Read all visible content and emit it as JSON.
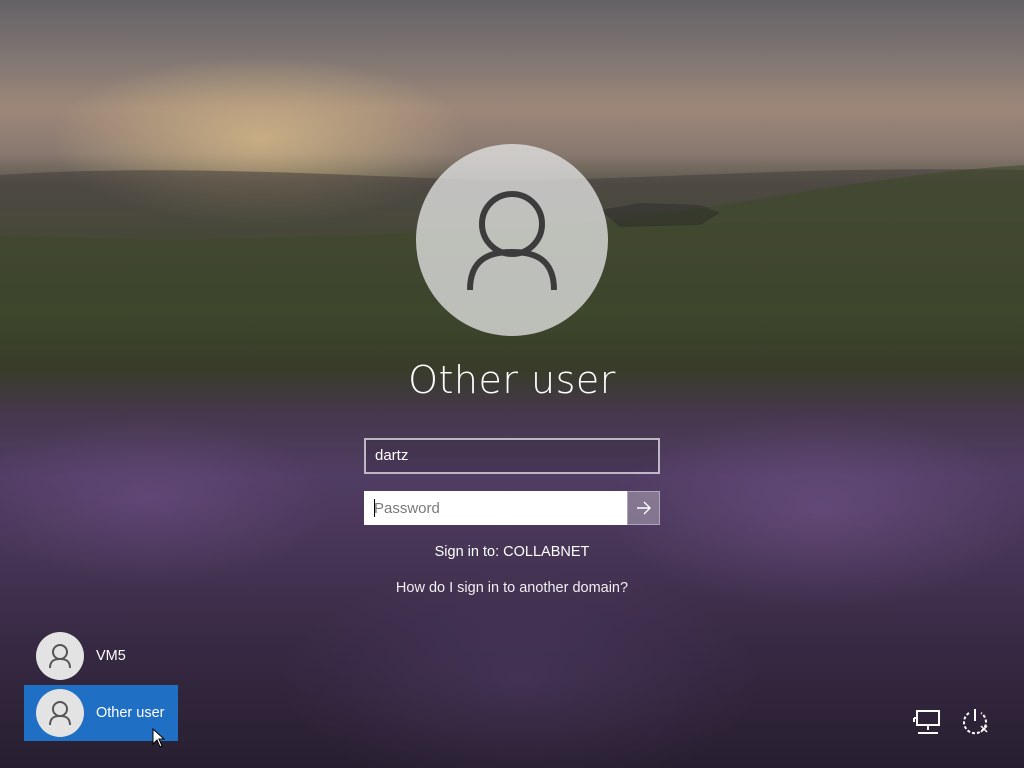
{
  "login": {
    "title": "Other user",
    "username_value": "dartz",
    "password_placeholder": "Password",
    "sign_in_to": "Sign in to: COLLABNET",
    "other_domain_link": "How do I sign in to another domain?"
  },
  "users": [
    {
      "label": "VM5",
      "selected": false,
      "icon": "user-icon"
    },
    {
      "label": "Other user",
      "selected": true,
      "icon": "user-icon"
    }
  ],
  "corner": {
    "network_icon": "network-icon",
    "power_icon": "power-icon"
  },
  "colors": {
    "accent": "#1f6fc4"
  }
}
